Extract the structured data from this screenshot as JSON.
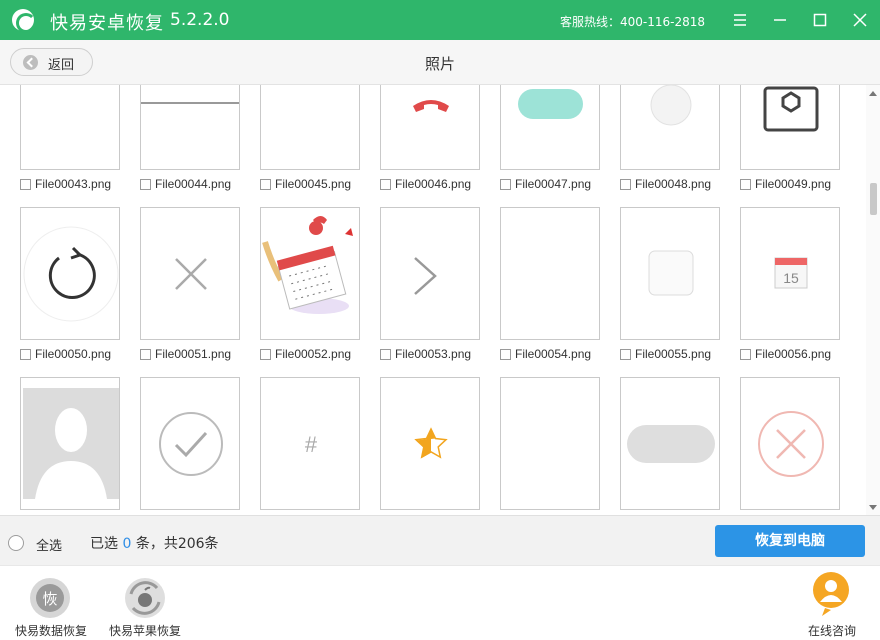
{
  "titlebar": {
    "app_name": "快易安卓恢复",
    "version": "5.2.2.0",
    "hotline": "客服热线：400-116-2818"
  },
  "subbar": {
    "back_label": "返回",
    "title": "照片"
  },
  "files": [
    "File00043.png",
    "File00044.png",
    "File00045.png",
    "File00046.png",
    "File00047.png",
    "File00048.png",
    "File00049.png",
    "File00050.png",
    "File00051.png",
    "File00052.png",
    "File00053.png",
    "File00054.png",
    "File00055.png",
    "File00056.png"
  ],
  "calendar_day": "15",
  "hash_symbol": "#",
  "selection": {
    "select_all_label": "全选",
    "prefix": "已选",
    "count": "0",
    "suffix": "条，共206条"
  },
  "restore_button": "恢复到电脑",
  "footer": {
    "data_recovery_label": "快易数据恢复",
    "data_recovery_icon_text": "恢",
    "apple_recovery_label": "快易苹果恢复",
    "consult_label": "在线咨询"
  },
  "colors": {
    "title_green": "#2fb66b",
    "accent_blue": "#2c94e6",
    "count_blue": "#2f8ee6",
    "consult_orange": "#f5a623"
  }
}
